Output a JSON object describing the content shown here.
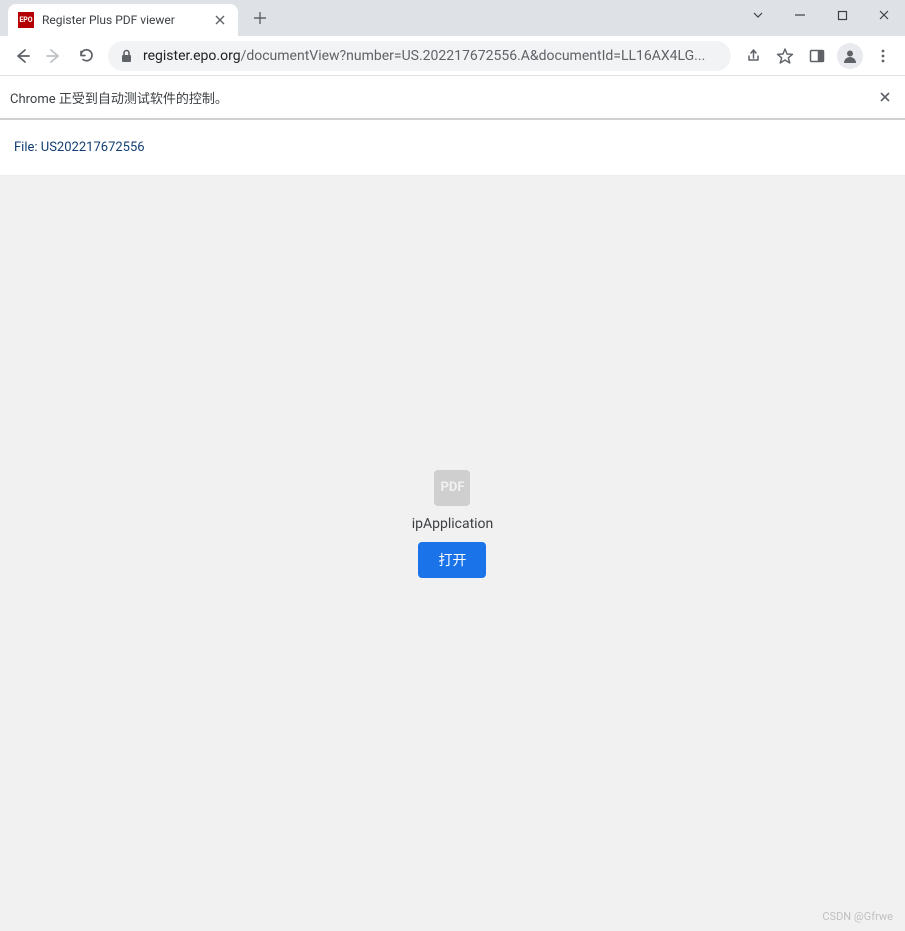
{
  "window": {
    "tab_title": "Register Plus PDF viewer",
    "favicon_text": "EPO"
  },
  "toolbar": {
    "url_host": "register.epo.org",
    "url_path": "/documentView?number=US.202217672556.A&documentId=LL16AX4LG..."
  },
  "infobar": {
    "message": "Chrome 正受到自动测试软件的控制。"
  },
  "content": {
    "file_label": "File: US202217672556",
    "pdf_icon_text": "PDF",
    "pdf_name": "ipApplication",
    "open_button": "打开"
  },
  "watermark": "CSDN @Gfrwe"
}
